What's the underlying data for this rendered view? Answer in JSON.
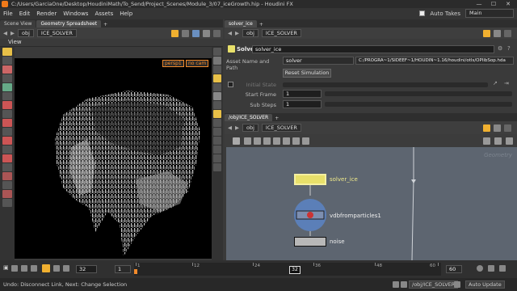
{
  "window": {
    "title": "C:/Users/GarciaOne/Desktop/HoudiniMath/To_Send/Project_Scenes/Module_3/07_iceGrowth.hip - Houdini FX",
    "min": "—",
    "max": "☐",
    "close": "✕"
  },
  "menu": {
    "items": [
      "File",
      "Edit",
      "Render",
      "Windows",
      "Assets",
      "Help"
    ],
    "auto_takes_label": "Auto Takes",
    "desktop": "Main"
  },
  "left_pane": {
    "tabs": [
      "Scene View",
      "Geometry Spreadsheet"
    ],
    "path": [
      "obj",
      "ICE_SOLVER"
    ],
    "viewport_label": "View",
    "camera": "persp1",
    "cam_menu": "no cam"
  },
  "param_pane": {
    "tabs": [
      "solver_ice"
    ],
    "path": [
      "obj",
      "ICE_SOLVER"
    ],
    "node_type": "Solver",
    "node_name": "solver_ice",
    "asset_label": "Asset Name and Path",
    "asset_name": "solver",
    "asset_path": "C:/PROGRA~1/SIDEEF~1/HOUDIN~1.16/houdini/otls/OPlibSop.hda",
    "reset_button": "Reset Simulation",
    "initial_state_label": "Initial State",
    "start_frame_label": "Start Frame",
    "start_frame": "1",
    "sub_steps_label": "Sub Steps",
    "sub_steps": "1"
  },
  "network_pane": {
    "tabs": [
      "/obj/ICE_SOLVER"
    ],
    "path": [
      "obj",
      "ICE_SOLVER"
    ],
    "watermark": "Geometry",
    "nodes": [
      {
        "name": "solver_ice"
      },
      {
        "name": "vdbfromparticles1"
      },
      {
        "name": "noise"
      }
    ]
  },
  "timeline": {
    "current_frame": "32",
    "start": "1",
    "playhead": "32",
    "end_frame": "60",
    "end_field": "60",
    "tick_labels": [
      "1",
      "12",
      "24",
      "36",
      "48",
      "60"
    ]
  },
  "status": {
    "message": "Undo: Disconnect Link, Next: Change Selection",
    "network_path": "/obj/ICE_SOLVER",
    "auto_update": "Auto Update"
  },
  "colors": {
    "accent": "#f28a2b",
    "node_selected": "#e8e06a",
    "vdb_node": "#5b7fb8",
    "network_bg": "#5d6570"
  }
}
